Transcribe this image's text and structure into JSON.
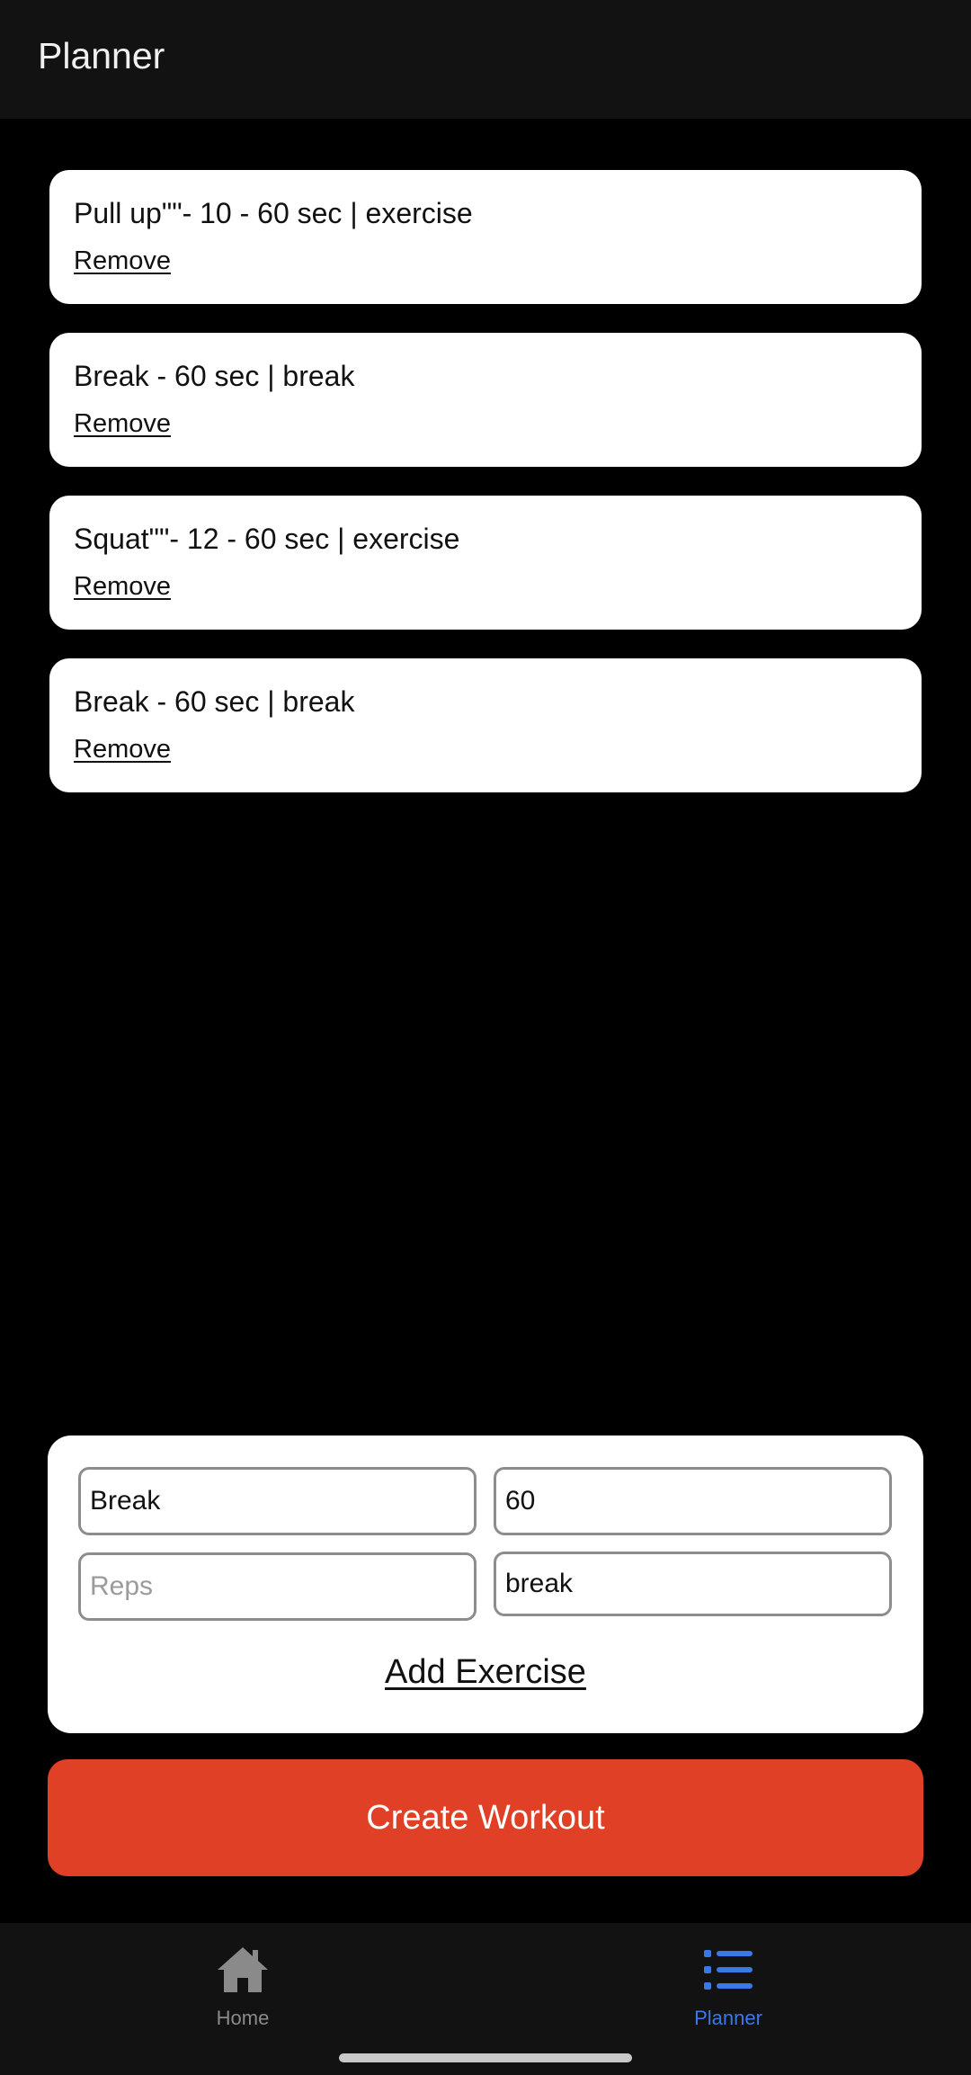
{
  "app": {
    "title": "Planner"
  },
  "exercises": [
    {
      "text": "Pull up\"\"- 10 - 60 sec | exercise",
      "remove_label": "Remove"
    },
    {
      "text": "Break - 60 sec | break",
      "remove_label": "Remove"
    },
    {
      "text": "Squat\"\"- 12 - 60 sec | exercise",
      "remove_label": "Remove"
    },
    {
      "text": "Break - 60 sec | break",
      "remove_label": "Remove"
    }
  ],
  "form": {
    "name_value": "Break",
    "duration_value": "60",
    "reps_value": "",
    "reps_placeholder": "Reps",
    "type_value": "break",
    "add_label": "Add Exercise"
  },
  "create_button_label": "Create Workout",
  "nav": {
    "active": "planner",
    "active_color": "#3b78e7",
    "inactive_color": "#8a8a8a",
    "items": [
      {
        "label": "Home",
        "icon": "home-icon"
      },
      {
        "label": "Planner",
        "icon": "list-icon"
      }
    ]
  },
  "colors": {
    "accent": "#e04026",
    "header_bg": "#121212",
    "background": "#000000"
  }
}
